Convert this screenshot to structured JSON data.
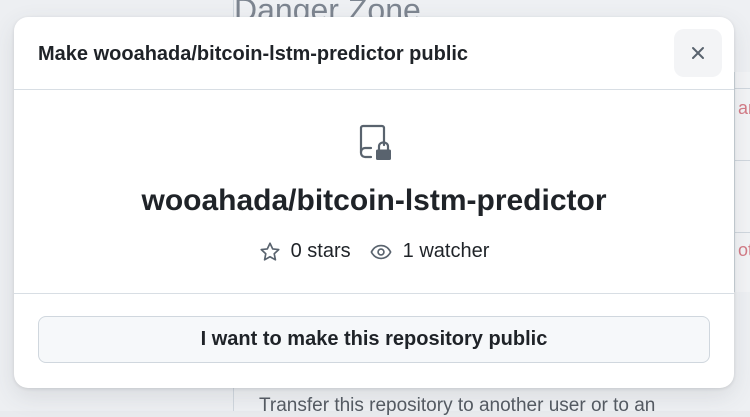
{
  "background": {
    "section_title": "Danger Zone",
    "right_edge_texts": [
      "an",
      "ote"
    ],
    "bottom_text": "Transfer this repository to another user or to an"
  },
  "modal": {
    "title": "Make wooahada/bitcoin-lstm-predictor public",
    "close_icon": "x-icon",
    "repo_icon": "repo-locked-icon",
    "repo_name": "wooahada/bitcoin-lstm-predictor",
    "stars_icon": "star-icon",
    "stars_label": "0 stars",
    "watchers_icon": "eye-icon",
    "watchers_label": "1 watcher",
    "confirm_label": "I want to make this repository public"
  },
  "colors": {
    "text": "#1f2328",
    "muted": "#59636e",
    "border": "#d0d7de",
    "danger_text": "#d1242f"
  }
}
